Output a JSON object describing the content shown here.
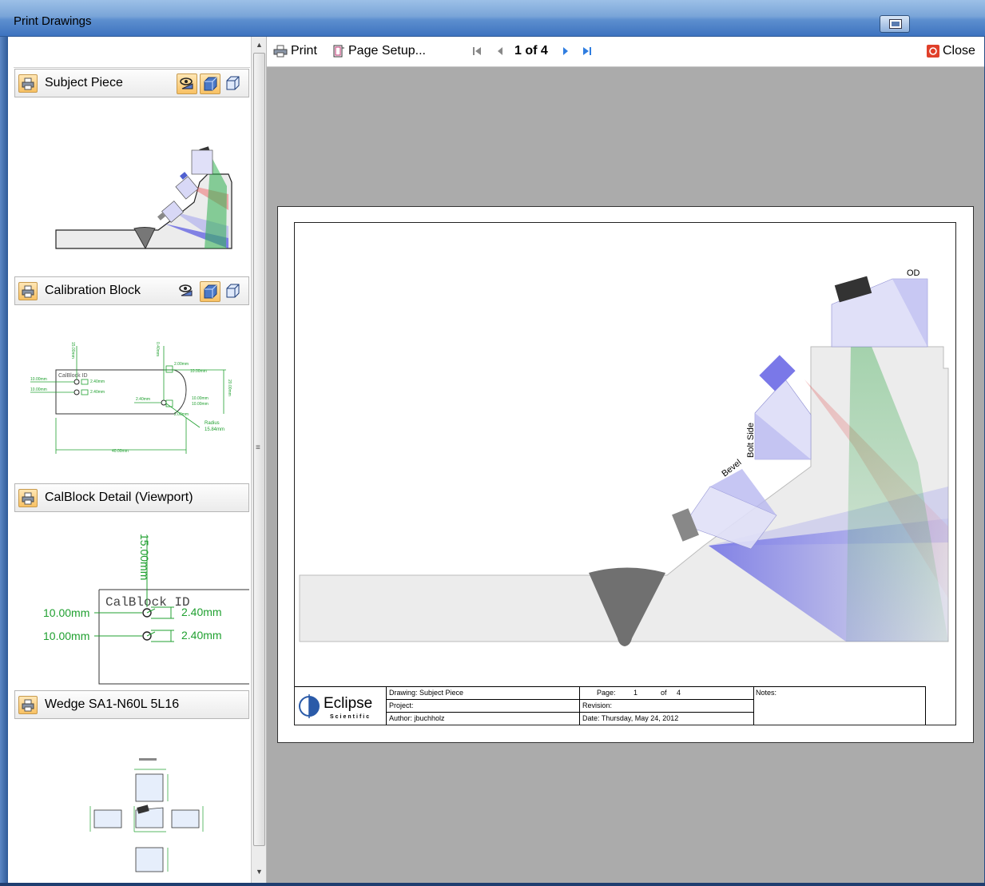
{
  "window": {
    "title": "Print Drawings"
  },
  "toolbar": {
    "print_label": "Print",
    "page_setup_label": "Page Setup...",
    "page_indicator": "1 of 4",
    "close_label": "Close"
  },
  "drawings": [
    {
      "label": "Subject Piece"
    },
    {
      "label": "Calibration Block"
    },
    {
      "label": "CalBlock Detail (Viewport)"
    },
    {
      "label": "Wedge SA1-N60L 5L16"
    }
  ],
  "calblock_thumb": {
    "dims": [
      "15.00mm",
      "10.00mm",
      "10.00mm",
      "2.40mm",
      "2.40mm",
      "0.40mm",
      "2.00mm",
      "10.00mm",
      "20.00mm",
      "2.40mm",
      "10.00mm",
      "10.00mm",
      "2.00mm",
      "Radius",
      "15.84mm",
      "40.00mm"
    ],
    "block_id": "CalBlock ID"
  },
  "viewport_thumb": {
    "dim_vertical": "15.00mm",
    "block_id": "CalBlock ID",
    "left_dim_1": "10.00mm",
    "left_dim_2": "10.00mm",
    "right_dim_1": "2.40mm",
    "right_dim_2": "2.40mm"
  },
  "preview": {
    "labels": {
      "od": "OD",
      "bolt_side": "Bolt Side",
      "bevel": "Bevel"
    },
    "title_block": {
      "logo_name": "Eclipse",
      "logo_sub": "Scientific",
      "drawing": "Drawing: Subject Piece",
      "project": "Project:",
      "author": "Author:   jbuchholz",
      "page_label": "Page:",
      "page_num": "1",
      "of_label": "of",
      "page_total": "4",
      "revision": "Revision:",
      "date": "Date:  Thursday, May 24, 2012",
      "notes": "Notes:"
    }
  },
  "colors": {
    "green": "#22a33a",
    "red": "#e05050",
    "blue": "#2020e0",
    "probe": "#7a78e8"
  }
}
